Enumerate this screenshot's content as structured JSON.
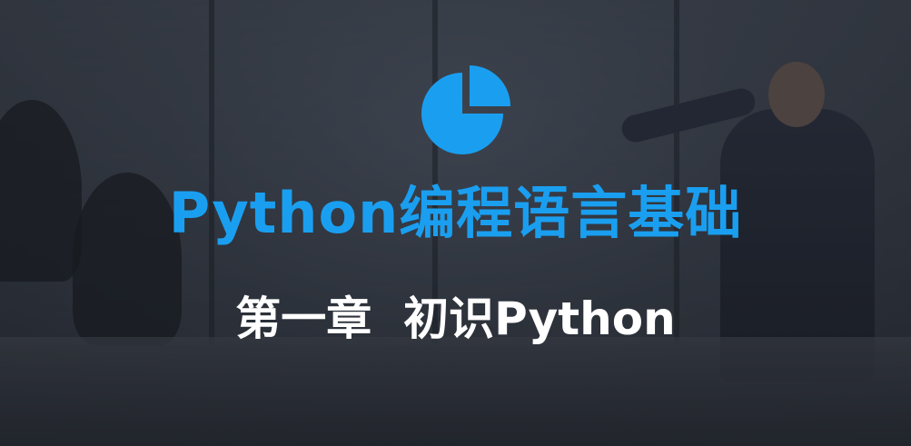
{
  "slide": {
    "icon": "pie-chart-icon",
    "title": "Python编程语言基础",
    "subtitle": "第一章  初识Python",
    "colors": {
      "accent": "#1a9ff0",
      "subtitle": "#ffffff",
      "overlay": "#2a2f38"
    }
  }
}
